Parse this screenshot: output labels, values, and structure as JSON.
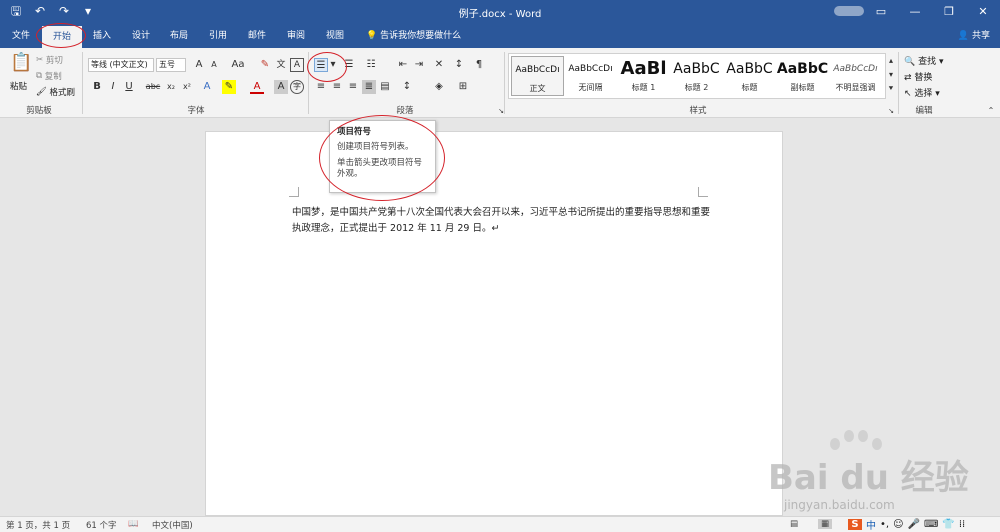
{
  "window": {
    "title": "例子.docx - Word"
  },
  "tabs": [
    "文件",
    "开始",
    "插入",
    "设计",
    "布局",
    "引用",
    "邮件",
    "审阅",
    "视图"
  ],
  "tell_me": "告诉我你想要做什么",
  "share": "共享",
  "clipboard": {
    "paste": "粘贴",
    "cut": "剪切",
    "copy": "复制",
    "format_painter": "格式刷",
    "label": "剪贴板"
  },
  "font": {
    "name": "等线 (中文正文)",
    "size": "五号",
    "label": "字体",
    "grow": "A",
    "shrink": "A",
    "case": "Aa",
    "bold": "B",
    "italic": "I",
    "underline": "U",
    "strike": "abc",
    "subscript": "x₂",
    "superscript": "x²",
    "wen": "文",
    "box": "A"
  },
  "paragraph": {
    "label": "段落"
  },
  "styles": {
    "label": "样式",
    "items": [
      {
        "preview": "AaBbCcDı",
        "name": "正文"
      },
      {
        "preview": "AaBbCcDı",
        "name": "无间隔"
      },
      {
        "preview": "AaBl",
        "name": "标题 1"
      },
      {
        "preview": "AaBbC",
        "name": "标题 2"
      },
      {
        "preview": "AaBbC",
        "name": "标题"
      },
      {
        "preview": "AaBbC",
        "name": "副标题"
      },
      {
        "preview": "AaBbCcDı",
        "name": "不明显强调"
      }
    ]
  },
  "editing": {
    "find": "查找",
    "replace": "替换",
    "select": "选择",
    "label": "编辑"
  },
  "tooltip": {
    "title": "项目符号",
    "line1": "创建项目符号列表。",
    "line2": "单击箭头更改项目符号外观。"
  },
  "document": {
    "text": "中国梦，是中国共产党第十八次全国代表大会召开以来，习近平总书记所提出的重要指导思想和重要执政理念，正式提出于 2012 年 11 月 29 日。↵"
  },
  "status": {
    "page": "第 1 页，共 1 页",
    "words": "61 个字",
    "lang": "中文(中国)"
  },
  "watermark": {
    "brand": "Bai du 经验",
    "url": "jingyan.baidu.com"
  },
  "accent": "#2b579a",
  "mark_color": "#d4222a"
}
